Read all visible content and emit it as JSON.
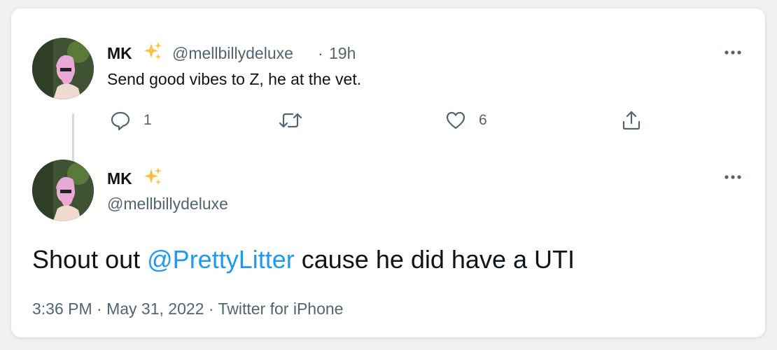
{
  "parent_tweet": {
    "display_name": "MK",
    "handle": "@mellbillydeluxe",
    "separator": "·",
    "time_ago": "19h",
    "text": "Send good vibes to Z, he at the vet.",
    "reply_count": "1",
    "retweet_count": "",
    "like_count": "6"
  },
  "main_tweet": {
    "display_name": "MK",
    "handle": "@mellbillydeluxe",
    "text_before": "Shout out ",
    "mention": "@PrettyLitter",
    "text_after": " cause he did have a UTI",
    "timestamp": "3:36 PM · May 31, 2022 · Twitter for iPhone"
  },
  "icons": {
    "badge": "sparkles-icon",
    "more": "more-horizontal-icon",
    "reply": "reply-icon",
    "retweet": "retweet-icon",
    "like": "heart-icon",
    "share": "share-icon"
  },
  "colors": {
    "text": "#0f1419",
    "muted": "#536471",
    "link": "#1d9bf0",
    "sparkle": "#f7c245"
  }
}
